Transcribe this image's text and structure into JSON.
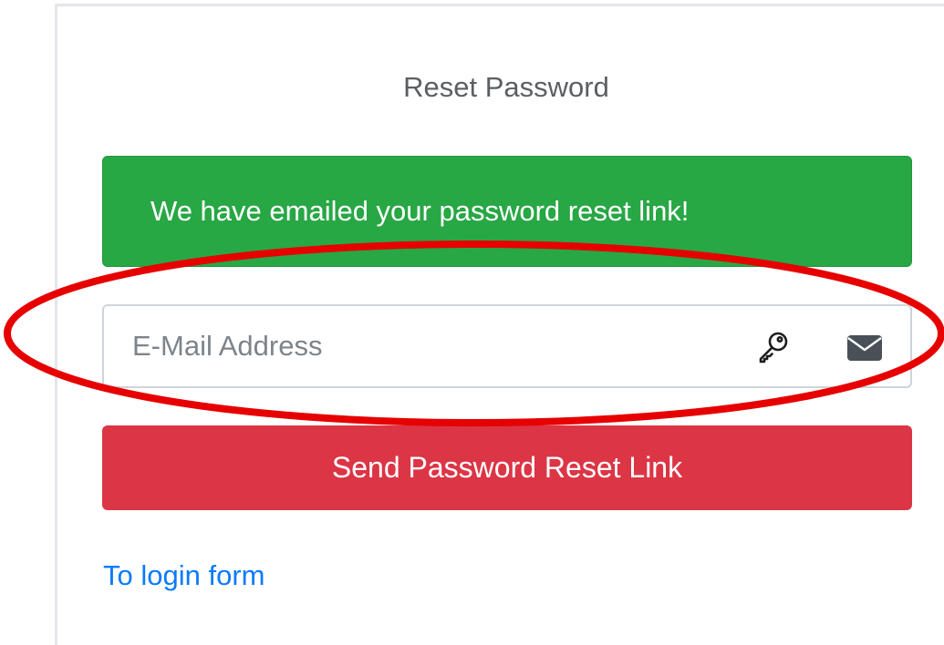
{
  "card": {
    "title": "Reset Password"
  },
  "alert": {
    "message": "We have emailed your password reset link!",
    "color": "#28a745"
  },
  "email_field": {
    "placeholder": "E-Mail Address",
    "value": "",
    "icons": [
      "key-icon",
      "envelope-icon"
    ]
  },
  "submit_button": {
    "label": "Send Password Reset Link",
    "color": "#dc3545"
  },
  "login_link": {
    "label": "To login form",
    "color": "#0a7bfb"
  },
  "annotation": {
    "shape": "ellipse",
    "color": "#e60000",
    "target": "email-field"
  }
}
